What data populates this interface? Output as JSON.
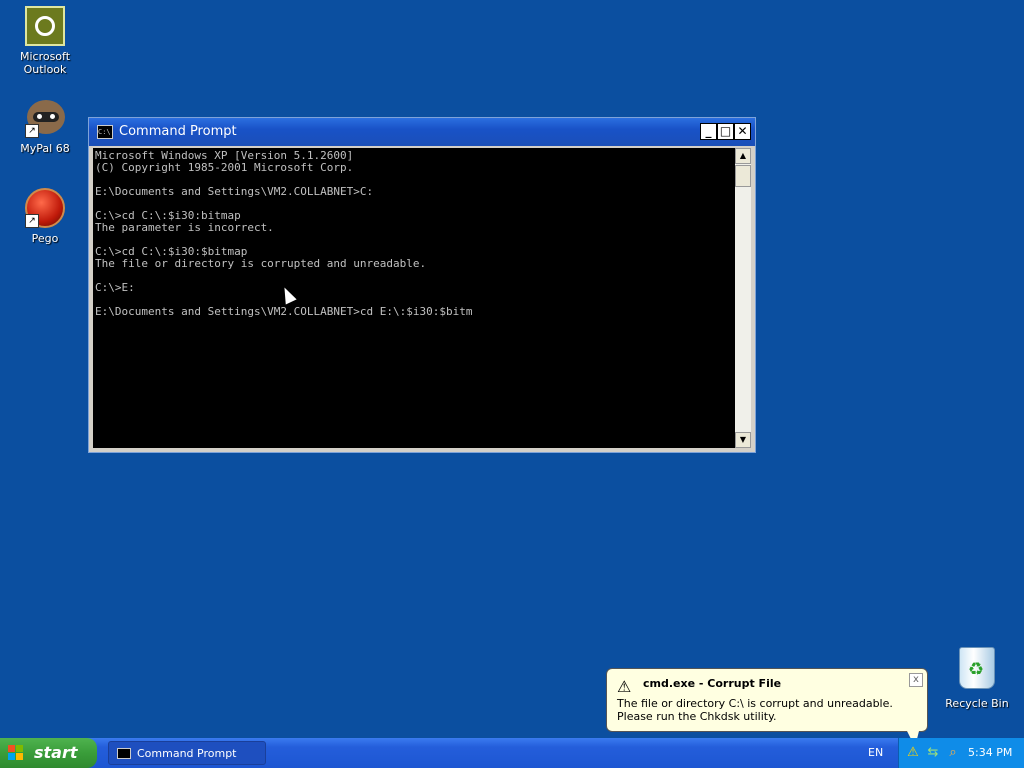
{
  "desktop": {
    "icons": [
      {
        "label": "Microsoft Outlook",
        "icon": "outlook-icon"
      },
      {
        "label": "MyPal 68",
        "icon": "raccoon-icon"
      },
      {
        "label": "Pego",
        "icon": "red-ball-icon"
      },
      {
        "label": "Recycle Bin",
        "icon": "recycle-bin-icon"
      }
    ]
  },
  "window": {
    "title": "Command Prompt",
    "minimize": "_",
    "maximize": "□",
    "close": "✕",
    "console_text": "Microsoft Windows XP [Version 5.1.2600]\n(C) Copyright 1985-2001 Microsoft Corp.\n\nE:\\Documents and Settings\\VM2.COLLABNET>C:\n\nC:\\>cd C:\\:$i30:bitmap\nThe parameter is incorrect.\n\nC:\\>cd C:\\:$i30:$bitmap\nThe file or directory is corrupted and unreadable.\n\nC:\\>E:\n\nE:\\Documents and Settings\\VM2.COLLABNET>cd E:\\:$i30:$bitm"
  },
  "balloon": {
    "title": "cmd.exe - Corrupt File",
    "text": "The file or directory C:\\ is corrupt and unreadable. Please run the Chkdsk utility.",
    "close": "x"
  },
  "taskbar": {
    "start_label": "start",
    "task_label": "Command Prompt",
    "language": "EN",
    "clock": "5:34 PM"
  },
  "colors": {
    "desktop": "#0b4fa0",
    "titlebar": "#1952c7",
    "start_green": "#3a9d3a",
    "tray": "#0f8ce8"
  }
}
